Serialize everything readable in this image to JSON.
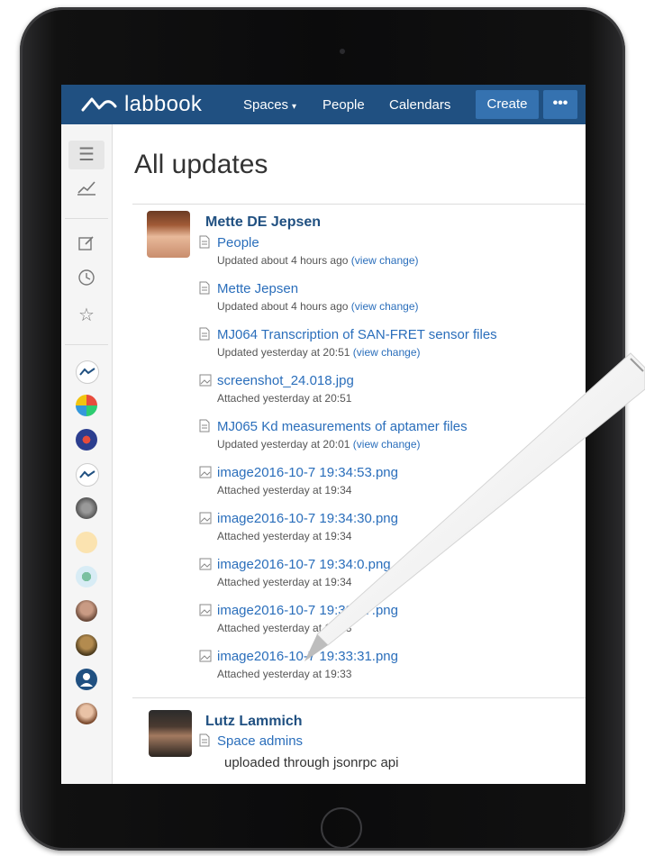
{
  "nav": {
    "brand": "labbook",
    "spaces": "Spaces",
    "people": "People",
    "calendars": "Calendars",
    "create": "Create",
    "more": "•••"
  },
  "page": {
    "title": "All updates"
  },
  "updates": [
    {
      "user": "Mette DE Jepsen",
      "items": [
        {
          "title": "People",
          "sub": "Updated about 4 hours ago",
          "link": "(view change)",
          "icon": "page-icon"
        },
        {
          "title": "Mette Jepsen",
          "sub": "Updated about 4 hours ago",
          "link": "(view change)",
          "icon": "page-icon"
        },
        {
          "title": "MJ064 Transcription of SAN-FRET sensor files",
          "sub": "Updated yesterday at 20:51",
          "link": "(view change)",
          "icon": "page-icon"
        },
        {
          "title": "screenshot_24.018.jpg",
          "sub": "Attached yesterday at 20:51",
          "link": "",
          "icon": "image-icon"
        },
        {
          "title": "MJ065 Kd measurements of aptamer files",
          "sub": "Updated yesterday at 20:01",
          "link": "(view change)",
          "icon": "page-icon"
        },
        {
          "title": "image2016-10-7 19:34:53.png",
          "sub": "Attached yesterday at 19:34",
          "link": "",
          "icon": "image-icon"
        },
        {
          "title": "image2016-10-7 19:34:30.png",
          "sub": "Attached yesterday at 19:34",
          "link": "",
          "icon": "image-icon"
        },
        {
          "title": "image2016-10-7 19:34:0.png",
          "sub": "Attached yesterday at 19:34",
          "link": "",
          "icon": "image-icon"
        },
        {
          "title": "image2016-10-7 19:33:47.png",
          "sub": "Attached yesterday at 19:33",
          "link": "",
          "icon": "image-icon"
        },
        {
          "title": "image2016-10-7 19:33:31.png",
          "sub": "Attached yesterday at 19:33",
          "link": "",
          "icon": "image-icon"
        }
      ]
    },
    {
      "user": "Lutz Lammich",
      "items": [
        {
          "title": "Space admins",
          "sub": "",
          "link": "",
          "icon": "page-icon"
        }
      ],
      "note": "uploaded through jsonrpc api"
    }
  ],
  "colors": {
    "nav_bg": "#205081",
    "button_bg": "#3572b0",
    "link": "#2a6ebb"
  }
}
